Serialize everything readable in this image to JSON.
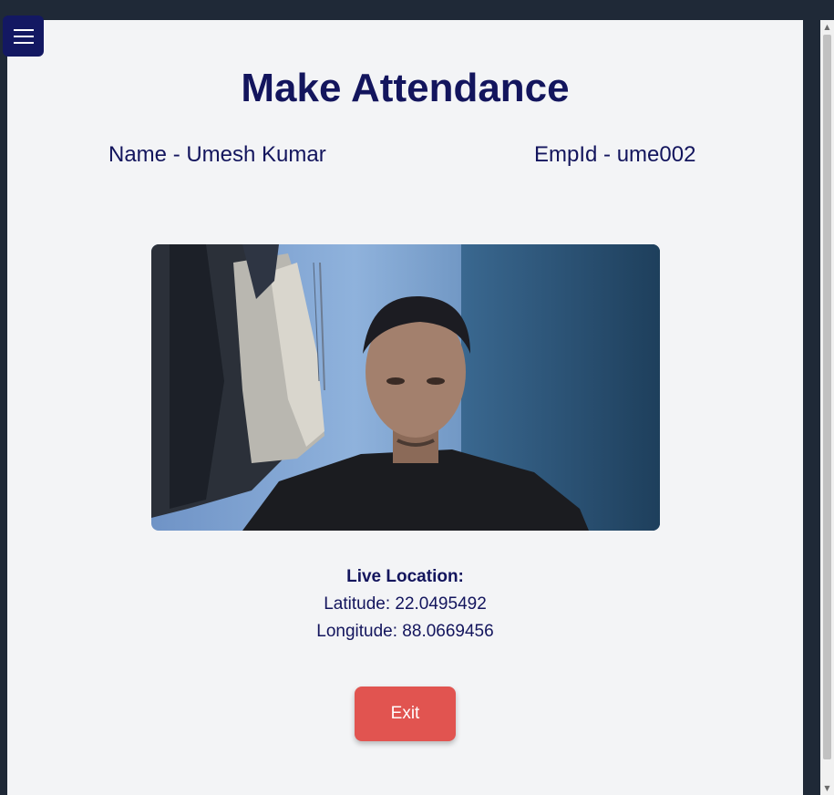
{
  "header": {
    "title": "Make Attendance",
    "menu_icon": "hamburger-menu-icon"
  },
  "employee": {
    "name_text": "Name - Umesh Kumar",
    "empid_text": "EmpId - ume002"
  },
  "camera": {
    "content": "live-webcam-feed"
  },
  "location": {
    "heading": "Live Location:",
    "latitude_text": "Latitude: 22.0495492",
    "longitude_text": "Longitude: 88.0669456"
  },
  "actions": {
    "exit_label": "Exit"
  },
  "colors": {
    "primary": "#13155d",
    "exit_button": "#e15450",
    "page_background": "#f3f4f6",
    "frame": "#1f2937"
  }
}
